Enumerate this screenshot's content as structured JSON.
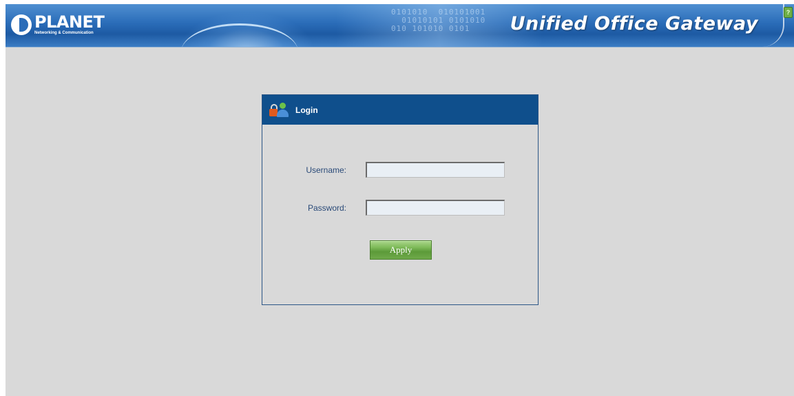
{
  "banner": {
    "logo_name": "PLANET",
    "logo_tagline": "Networking & Communication",
    "product_title": "Unified Office Gateway",
    "help_label": "?",
    "decor_binary": "0101010  010101001\n  01010101 0101010\n010 101010 0101"
  },
  "login": {
    "header_title": "Login",
    "username_label": "Username:",
    "username_value": "",
    "password_label": "Password:",
    "password_value": "",
    "apply_label": "Apply"
  },
  "colors": {
    "header_bg": "#0f4f8c",
    "page_bg": "#d9d9d9",
    "label_text": "#2a4a78",
    "apply_button": "#6fa94a"
  },
  "icons": {
    "login": "lock-user-icon",
    "logo": "planet-logo-icon",
    "help": "help-icon"
  }
}
